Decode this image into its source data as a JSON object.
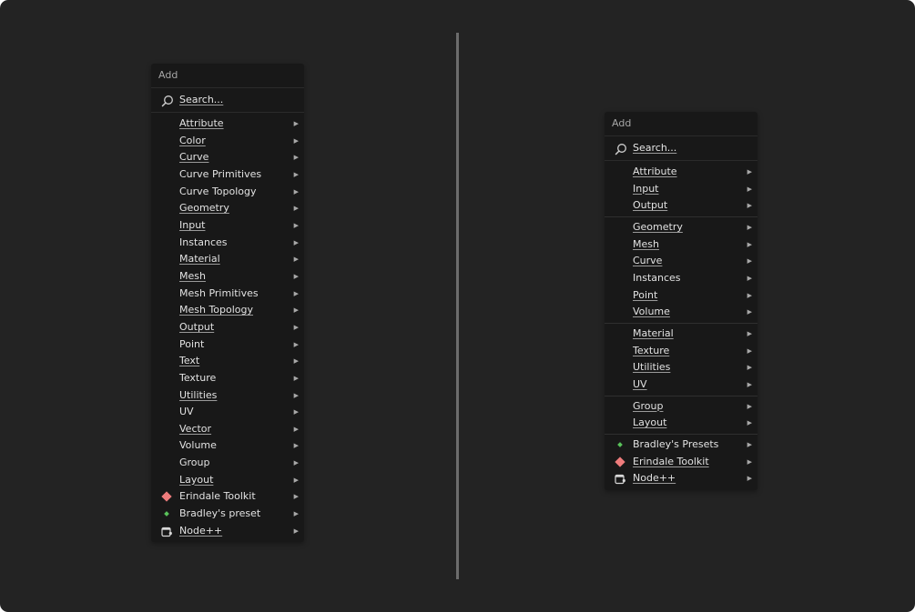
{
  "left_menu": {
    "title": "Add",
    "search_label": "Search...",
    "items": [
      {
        "label": "Attribute"
      },
      {
        "label": "Color"
      },
      {
        "label": "Curve"
      },
      {
        "label": "Curve Primitives"
      },
      {
        "label": "Curve Topology"
      },
      {
        "label": "Geometry"
      },
      {
        "label": "Input"
      },
      {
        "label": "Instances"
      },
      {
        "label": "Material"
      },
      {
        "label": "Mesh"
      },
      {
        "label": "Mesh Primitives"
      },
      {
        "label": "Mesh Topology"
      },
      {
        "label": "Output"
      },
      {
        "label": "Point"
      },
      {
        "label": "Text"
      },
      {
        "label": "Texture"
      },
      {
        "label": "Utilities"
      },
      {
        "label": "UV"
      },
      {
        "label": "Vector"
      },
      {
        "label": "Volume"
      },
      {
        "label": "Group"
      },
      {
        "label": "Layout"
      },
      {
        "label": "Erindale Toolkit",
        "icon": "red-diamond-icon"
      },
      {
        "label": "Bradley's preset",
        "icon": "green-diamond-icon"
      },
      {
        "label": "Node++",
        "icon": "node-plus-icon"
      }
    ]
  },
  "right_menu": {
    "title": "Add",
    "search_label": "Search...",
    "groups": [
      [
        {
          "label": "Attribute"
        },
        {
          "label": "Input"
        },
        {
          "label": "Output"
        }
      ],
      [
        {
          "label": "Geometry"
        },
        {
          "label": "Mesh"
        },
        {
          "label": "Curve"
        },
        {
          "label": "Instances"
        },
        {
          "label": "Point"
        },
        {
          "label": "Volume"
        }
      ],
      [
        {
          "label": "Material"
        },
        {
          "label": "Texture"
        },
        {
          "label": "Utilities"
        },
        {
          "label": "UV"
        }
      ],
      [
        {
          "label": "Group"
        },
        {
          "label": "Layout"
        }
      ],
      [
        {
          "label": "Bradley's Presets",
          "icon": "green-diamond-icon"
        },
        {
          "label": "Erindale Toolkit",
          "icon": "red-diamond-icon"
        },
        {
          "label": "Node++",
          "icon": "node-plus-icon"
        }
      ]
    ]
  },
  "icons": {
    "arrow": "▶",
    "submenu_arrow": "triangle-right-icon",
    "search": "magnifier-icon"
  },
  "colors": {
    "background": "#232323",
    "menu_background": "#181818",
    "text": "#e2e2e2",
    "muted_text": "#a6a6a6",
    "divider": "#6c6c6c",
    "red_diamond": "#ee7c7c",
    "green_diamond": "#59c25a"
  }
}
